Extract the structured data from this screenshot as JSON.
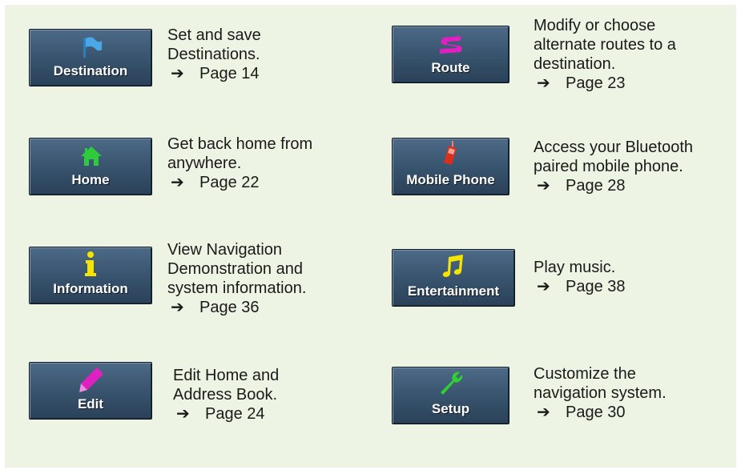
{
  "items": [
    {
      "button": "Destination",
      "text": [
        "Set and save",
        "Destinations."
      ],
      "page": "Page 14"
    },
    {
      "button": "Home",
      "text": [
        "Get back home from",
        "anywhere."
      ],
      "page": "Page 22"
    },
    {
      "button": "Information",
      "text": [
        "View Navigation",
        "Demonstration and",
        "system information."
      ],
      "page": "Page 36"
    },
    {
      "button": "Edit",
      "text": [
        "Edit Home and",
        "Address Book."
      ],
      "page": "Page 24"
    },
    {
      "button": "Route",
      "text": [
        "Modify or choose",
        "alternate routes to a",
        "destination."
      ],
      "page": "Page 23"
    },
    {
      "button": "Mobile Phone",
      "text": [
        "Access your Bluetooth",
        "paired mobile phone."
      ],
      "page": "Page 28"
    },
    {
      "button": "Entertainment",
      "text": [
        "Play music."
      ],
      "page": "Page 38"
    },
    {
      "button": "Setup",
      "text": [
        "Customize the",
        "navigation system."
      ],
      "page": "Page 30"
    }
  ],
  "arrow_glyph": "➔",
  "icons": [
    "flag-icon",
    "house-icon",
    "info-icon",
    "pencil-icon",
    "route-icon",
    "mobile-phone-icon",
    "music-note-icon",
    "wrench-icon"
  ],
  "colors": {
    "panel": "#eef4e3",
    "button": "#3a5671",
    "flag": "#4aa8e8",
    "house": "#2ecc3a",
    "info": "#f5e400",
    "pencil": "#e020c0",
    "route": "#e020c0",
    "phone": "#d83020",
    "music": "#f5e400",
    "wrench": "#30d030"
  }
}
